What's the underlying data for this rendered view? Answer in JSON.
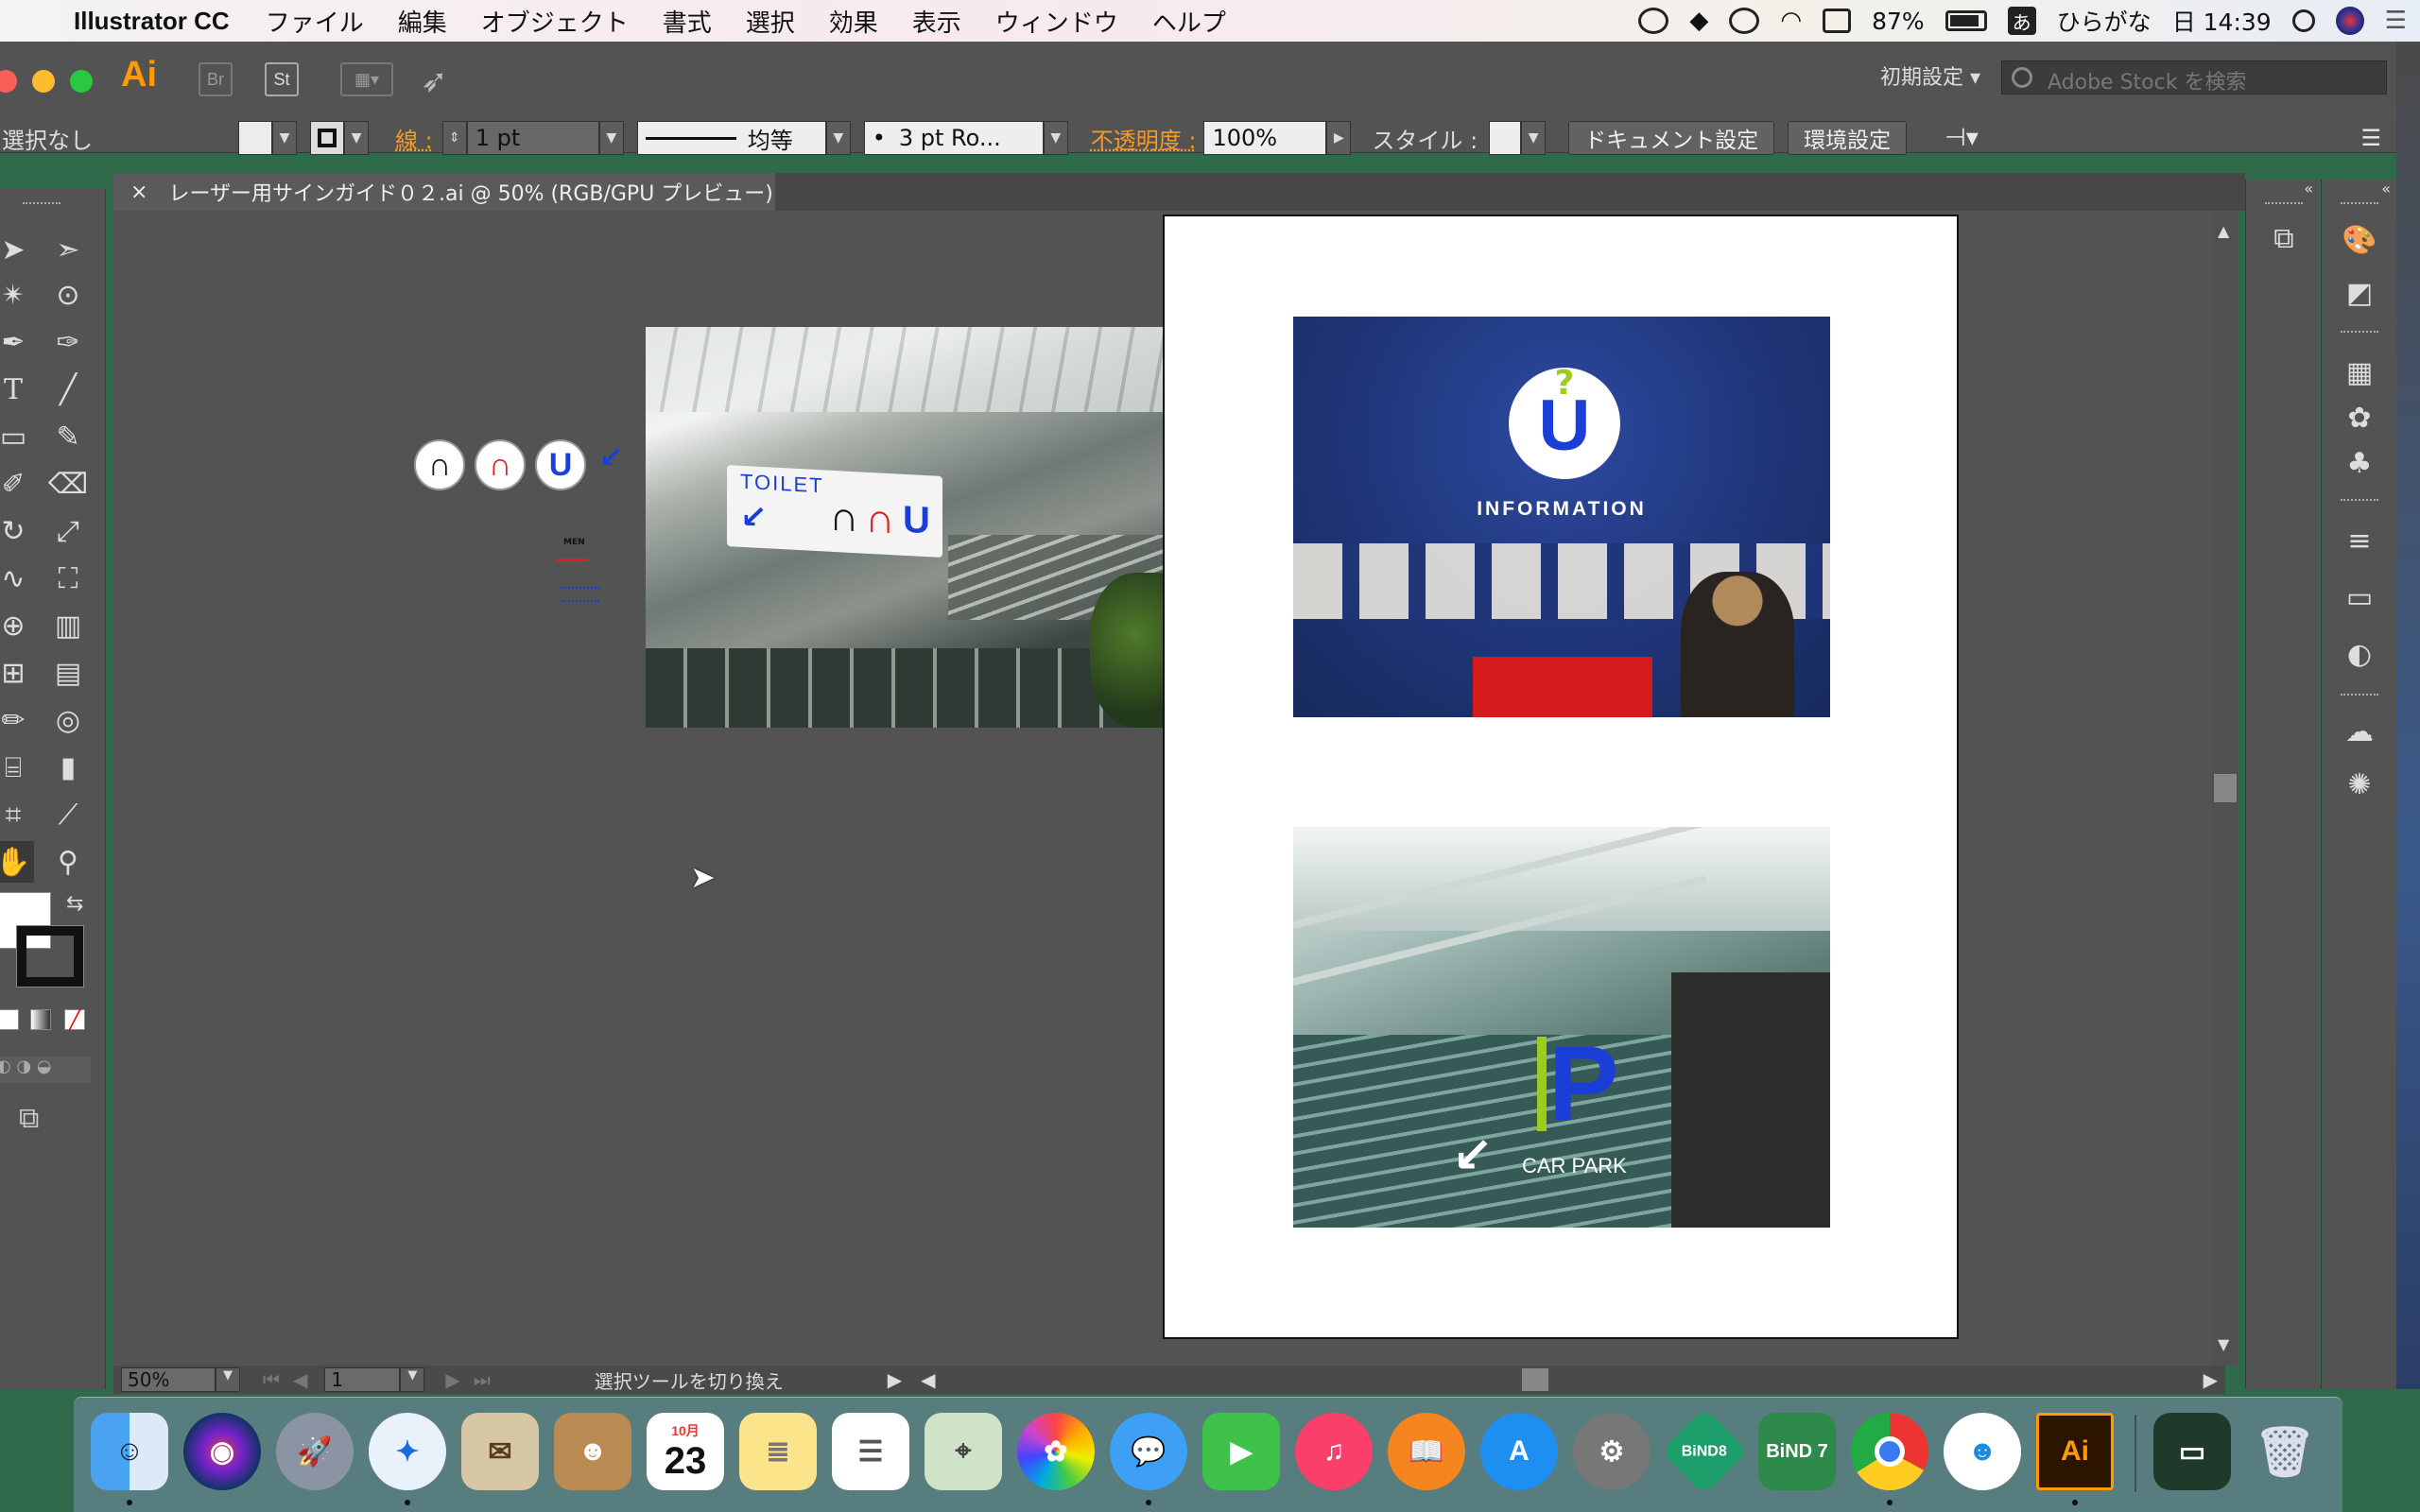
{
  "menubar": {
    "app_name": "Illustrator CC",
    "items": [
      "ファイル",
      "編集",
      "オブジェクト",
      "書式",
      "選択",
      "効果",
      "表示",
      "ウィンドウ",
      "ヘルプ"
    ],
    "battery": "87%",
    "ime_glyph": "あ",
    "ime_mode": "ひらがな",
    "clock": "日 14:39"
  },
  "appbar": {
    "logo": "Ai",
    "bridge": "Br",
    "stock": "St",
    "workspace": "初期設定",
    "stock_search_placeholder": "Adobe Stock を検索"
  },
  "control": {
    "selection": "選択なし",
    "stroke_label": "線 :",
    "stroke_weight": "1 pt",
    "profile": "均等",
    "brush": "3 pt Ro...",
    "opacity_label": "不透明度 :",
    "opacity": "100%",
    "style_label": "スタイル :",
    "doc_settings": "ドキュメント設定",
    "preferences": "環境設定"
  },
  "document_tab": {
    "close": "×",
    "title": "レーザー用サインガイド０２.ai @ 50% (RGB/GPU プレビュー)"
  },
  "canvas": {
    "small_label": "MEN",
    "toilet_sign": "TOILET",
    "info_sign": "INFORMATION",
    "info_glyph": "U",
    "info_question": "?",
    "parking_letter": "P",
    "parking_sign": "CAR PARK"
  },
  "status": {
    "zoom": "50%",
    "artboard": "1",
    "message": "選択ツールを切り換え"
  },
  "dock": {
    "calendar_month": "10月",
    "calendar_day": "23",
    "bind8": "BiND8",
    "bind7": "BiND 7",
    "ai": "Ai"
  },
  "colors": {
    "accent_orange": "#f39a2a",
    "ai_orange": "#ff9a00",
    "canvas_gray": "#535353"
  }
}
